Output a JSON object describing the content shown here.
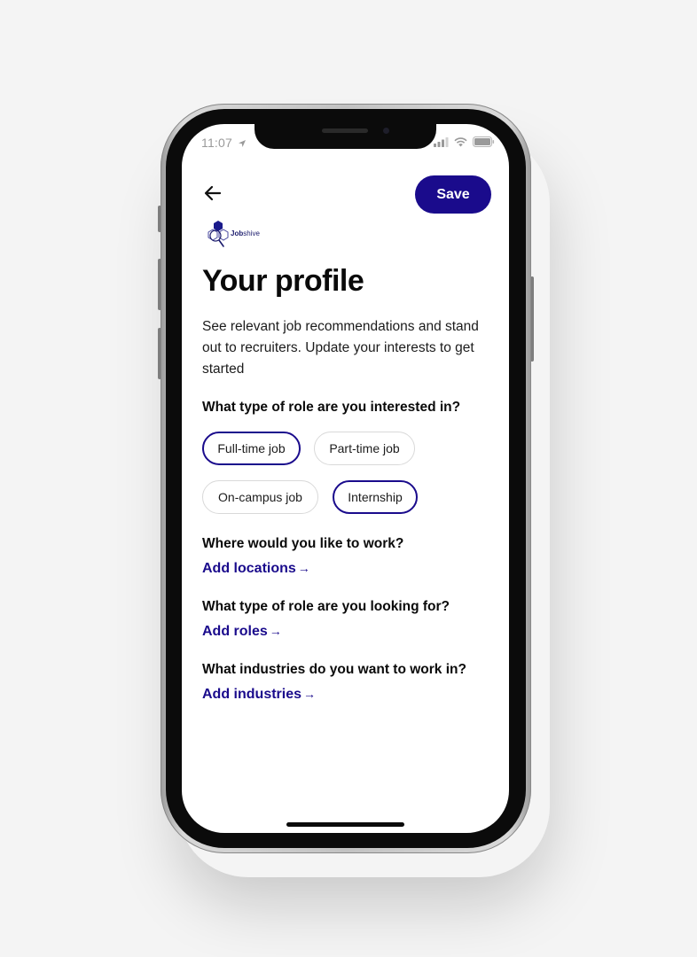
{
  "status_bar": {
    "time": "11:07"
  },
  "header": {
    "back_icon": "arrow-left-icon",
    "save_label": "Save"
  },
  "logo": {
    "bold_text": "Job",
    "rest_text": "shive"
  },
  "page": {
    "title": "Your profile",
    "intro": "See relevant job recommendations and stand out to recruiters. Update your interests to get started"
  },
  "questions": {
    "role_interest": "What type of role are you interested in?",
    "location": "Where would you like to work?",
    "role_type": "What type of role are you looking for?",
    "industries": "What industries do you want to work in?"
  },
  "chips": [
    {
      "label": "Full-time job",
      "selected": true
    },
    {
      "label": "Part-time job",
      "selected": false
    },
    {
      "label": "On-campus job",
      "selected": false
    },
    {
      "label": "Internship",
      "selected": true
    }
  ],
  "links": {
    "locations": "Add locations",
    "roles": "Add roles",
    "industries": "Add industries"
  },
  "colors": {
    "accent": "#1a0b8c",
    "chip_border": "#d9d9d9"
  }
}
